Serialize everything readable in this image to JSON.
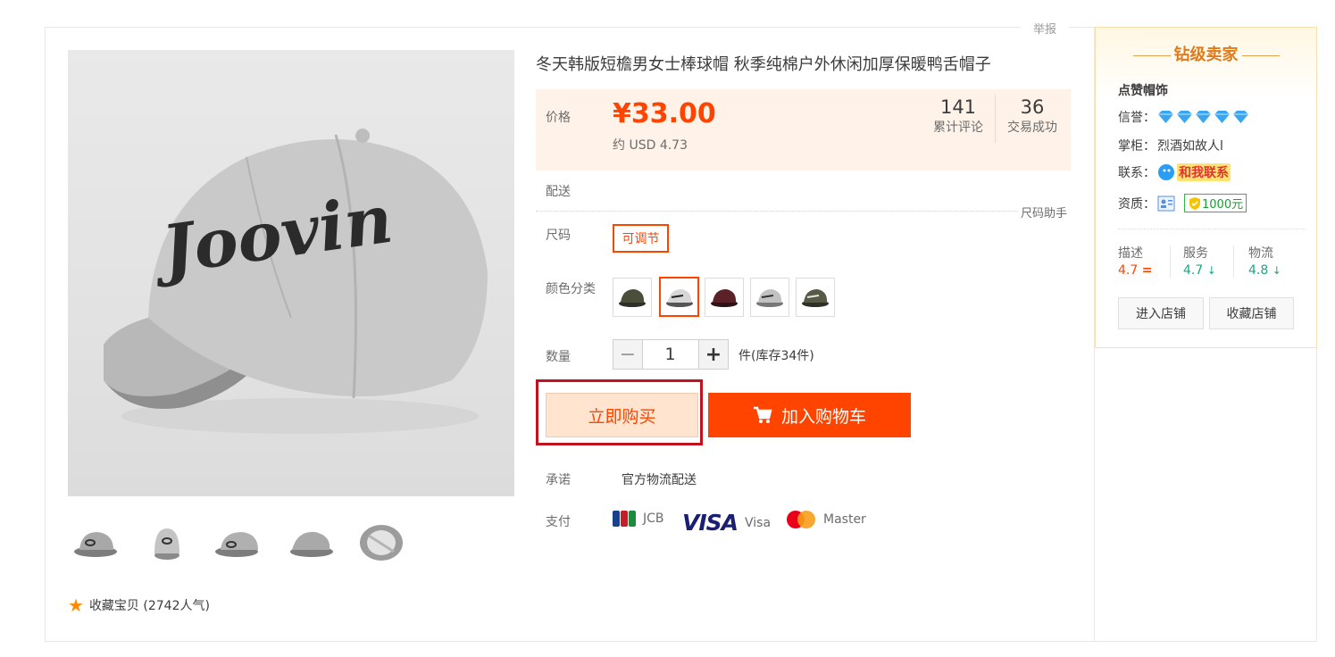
{
  "report": "举报",
  "product": {
    "title": "冬天韩版短檐男女士棒球帽 秋季纯棉户外休闲加厚保暖鸭舌帽子",
    "price_label": "价格",
    "price": "¥33.00",
    "usd": "约 USD 4.73",
    "reviews_count": "141",
    "reviews_label": "累计评论",
    "deals_count": "36",
    "deals_label": "交易成功",
    "delivery_label": "配送",
    "size_help": "尺码助手",
    "size_label": "尺码",
    "size_option": "可调节",
    "color_label": "颜色分类",
    "colors": [
      "green",
      "gray-white",
      "burgundy",
      "light-gray",
      "army-green"
    ],
    "selected_color_index": 1,
    "qty_label": "数量",
    "qty_minus": "−",
    "qty_value": "1",
    "qty_plus": "+",
    "stock": "件(库存34件)",
    "buy_now": "立即购买",
    "add_cart": "加入购物车",
    "promise_label": "承诺",
    "promise": "官方物流配送",
    "pay_label": "支付",
    "payments": [
      "JCB",
      "Visa",
      "Master"
    ],
    "favorite": "收藏宝贝 (2742人气)"
  },
  "gallery": {
    "embroidery": "Joovin",
    "thumbnail_count": 5
  },
  "seller": {
    "badge": "钻级卖家",
    "shop_name": "点赞帽饰",
    "credit_label": "信誉：",
    "credit_diamonds": 5,
    "keeper_label": "掌柜：",
    "keeper": "烈酒如故人l",
    "contact_label": "联系：",
    "contact": "和我联系",
    "qual_label": "资质：",
    "deposit": "1000元",
    "scores": [
      {
        "name": "描述",
        "value": "4.7",
        "trend": "=",
        "color": "#ff4400"
      },
      {
        "name": "服务",
        "value": "4.7",
        "trend": "↓",
        "color": "#1ba784"
      },
      {
        "name": "物流",
        "value": "4.8",
        "trend": "↓",
        "color": "#1ba784"
      }
    ],
    "enter_shop": "进入店铺",
    "fav_shop": "收藏店铺"
  },
  "colors": {
    "accent": "#ff4400",
    "price_bg": "#fff2e8",
    "highlight": "#c1121f"
  }
}
